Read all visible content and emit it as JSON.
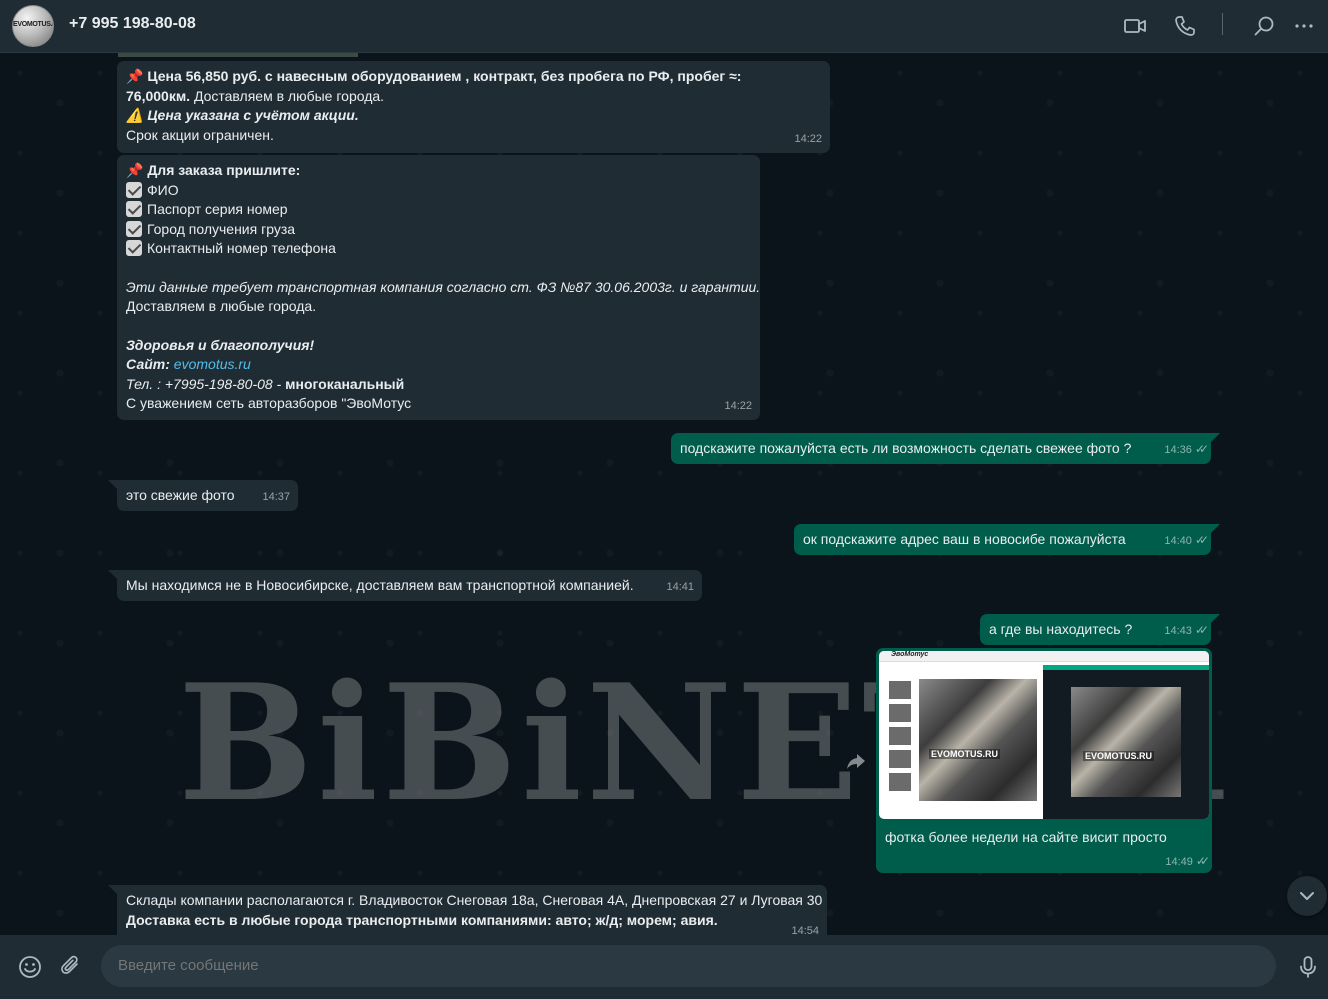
{
  "header": {
    "avatar_text": "EVOMOTUS.RU",
    "contact": "+7 995 198-80-08",
    "icons": [
      "video-call-icon",
      "voice-call-icon",
      "search-icon",
      "menu-icon"
    ]
  },
  "watermark": "BiBiNET.ru",
  "messages": {
    "m1": {
      "line1": "📌 Цена 56,850 руб. с навесным оборудованием , контракт, без пробега по РФ, пробег ≈:",
      "line2_bold": "76,000км.",
      "line2_rest": " Доставляем в любые города.",
      "line3": "⚠️ Цена указана с учётом  акции.",
      "line4": " Срок акции ограничен.",
      "time": "14:22"
    },
    "m2": {
      "title": "📌 Для заказа пришлите:",
      "items": [
        "ФИО",
        "Паспорт серия номер",
        "Город получения груза",
        "Контактный номер телефона"
      ],
      "legal": "Эти данные требует транспортная компания согласно ст. ФЗ №87 30.06.2003г.  и гарантии.",
      "delivery": "Доставляем в любые города.",
      "wish": "Здоровья и благополучия!",
      "site_label": " Сайт: ",
      "site_link": "evomotus.ru",
      "phone_label": " Тел. : +7995-198-80-08 - ",
      "phone_bold": "многоканальный",
      "sign": "С уважением сеть авторазборов \"ЭвоМотус",
      "time": "14:22"
    },
    "m3": {
      "text": "подскажите пожалуйста есть ли возможность сделать свежее фото ?",
      "time": "14:36"
    },
    "m4": {
      "text": "это свежие фото",
      "time": "14:37"
    },
    "m5": {
      "text": "ок подскажите адрес ваш в новосибе пожалуйста",
      "time": "14:40"
    },
    "m6": {
      "text": "Мы находимся не в Новосибирске, доставляем вам транспортной компанией.",
      "time": "14:41"
    },
    "m7": {
      "text": "а где вы находитесь ?",
      "time": "14:43"
    },
    "m8": {
      "caption": "фотка более недели на сайте висит просто",
      "time": "14:49",
      "img_logo": "ЭвоМотус",
      "img_label": "EVOMOTUS.RU"
    },
    "m9": {
      "line1": "Склады компании располагаются г. Владивосток Снеговая 18а, Снеговая 4А, Днепровская 27 и Луговая 30",
      "line2": "Доставка есть в любые города транспортными компаниями: авто; ж/д; морем; авия.",
      "time": "14:54"
    }
  },
  "composer": {
    "placeholder": "Введите сообщение",
    "icons": [
      "emoji-icon",
      "attach-icon",
      "microphone-icon"
    ]
  },
  "colors": {
    "header_bg": "#202c33",
    "chat_bg": "#0b141a",
    "incoming": "#202c33",
    "outgoing": "#005c4b",
    "link": "#53bdeb"
  }
}
